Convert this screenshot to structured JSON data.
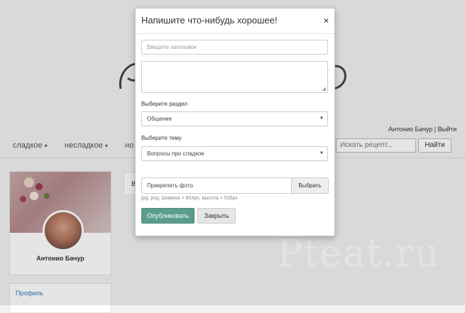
{
  "header": {
    "user_links": "Антонио Бачур | Выйти"
  },
  "nav": {
    "items": [
      {
        "label": "сладкое",
        "caret": "▾"
      },
      {
        "label": "несладкое",
        "caret": "▾"
      },
      {
        "label": "но",
        "caret": ""
      }
    ],
    "search_placeholder": "Искать рецепт...",
    "search_button": "Найти"
  },
  "profile": {
    "name": "Антонио Бачур",
    "link": "Профиль"
  },
  "content": {
    "snippet": "В"
  },
  "watermark": "Pteat.ru",
  "modal": {
    "title": "Напишите что-нибудь хорошее!",
    "close_icon": "×",
    "title_placeholder": "Введите заголовок",
    "section_label": "Выберите раздел",
    "section_value": "Общение",
    "topic_label": "Выберите тему",
    "topic_value": "Вопросы про сладкое",
    "file_placeholder": "Прикрепить фото",
    "file_button": "Выбрать",
    "file_hint": "jpg, png. Ширина > 803px, высота > 535px",
    "publish_button": "Опубликовать",
    "close_button": "Закрыть"
  },
  "colors": {
    "accent": "#5a9d8c",
    "link": "#337ab7"
  }
}
